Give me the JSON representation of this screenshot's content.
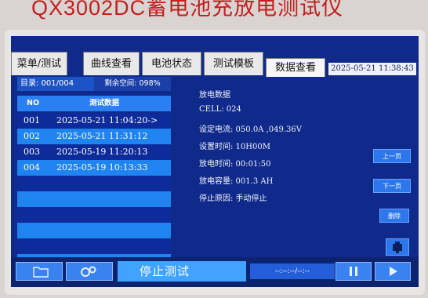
{
  "device": {
    "title": "QX3002DC蓄电池充放电测试仪"
  },
  "tabs": [
    {
      "label": "菜单/测试"
    },
    {
      "label": "曲线查看"
    },
    {
      "label": "电池状态"
    },
    {
      "label": "测试模板"
    },
    {
      "label": "数据查看"
    }
  ],
  "datetime": "2025-05-21 11:38:43",
  "directory": {
    "label": "目录: 001/004",
    "remain_label": "剩余空间: 098%"
  },
  "table": {
    "headers": [
      "NO",
      "测试数据"
    ],
    "rows": [
      {
        "no": "001",
        "datetime": "2025-05-21 11:04:20->"
      },
      {
        "no": "002",
        "datetime": "2025-05-21 11:31:12"
      },
      {
        "no": "003",
        "datetime": "2025-05-19 11:20:13"
      },
      {
        "no": "004",
        "datetime": "2025-05-19 10:13:33"
      }
    ]
  },
  "discharge": {
    "title": "放电数据",
    "cell": "CELL: 024",
    "set_current": "设定电流: 050.0A ,049.36V",
    "set_time": "设置时间: 10H00M",
    "discharge_time": "放电时间: 00:01:50",
    "capacity": "放电容量: 001.3 AH",
    "stop_reason": "停止原因: 手动停止"
  },
  "side_buttons": {
    "prev": "上一页",
    "next": "下一页",
    "delete": "删除"
  },
  "bottom": {
    "stop_label": "停止测试",
    "status_text": "--:--:--/--:--"
  },
  "colors": {
    "screen_bg": "#0f2a8a",
    "row_dark": "#0e2b9b",
    "row_light": "#1f84f0",
    "brand_red": "#c41e1e"
  },
  "icons": {
    "folder": "folder-icon",
    "gears": "gear-icon",
    "pause": "pause-icon",
    "play": "play-icon",
    "usb": "usb-icon"
  }
}
